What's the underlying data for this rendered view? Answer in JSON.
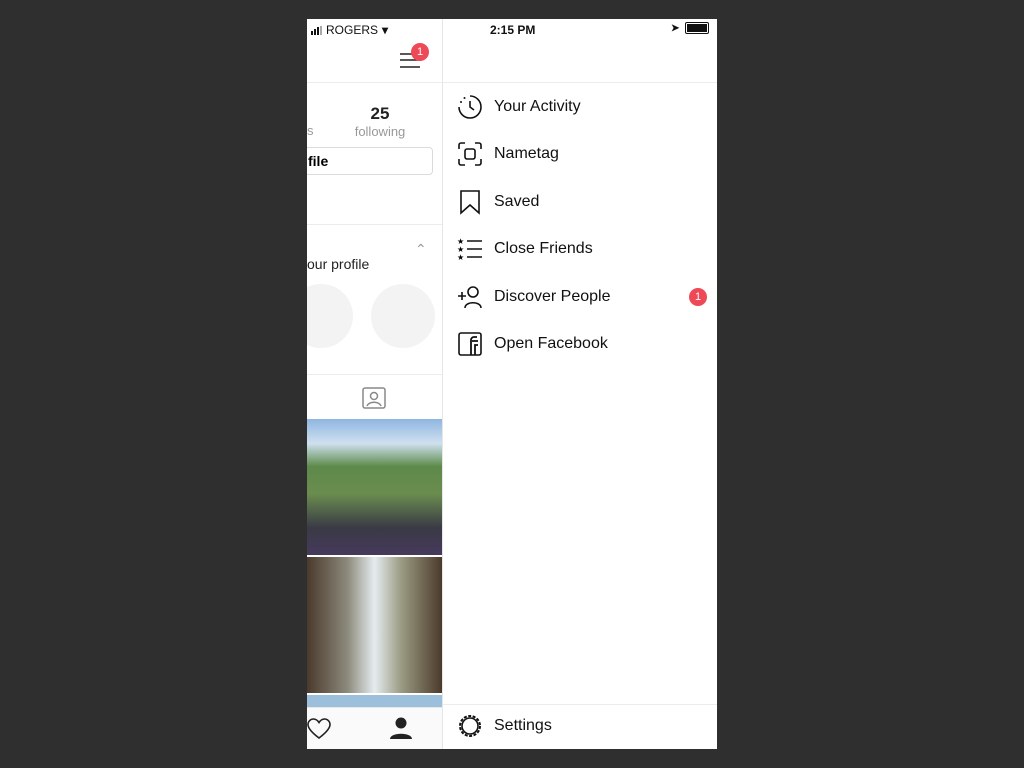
{
  "status_bar": {
    "carrier": "ROGERS",
    "time": "2:15 PM"
  },
  "profile": {
    "following_count": "25",
    "following_label": "following",
    "followers_label_partial": "s",
    "edit_profile_partial": "file",
    "suggested_partial": "our profile",
    "menu_badge": "1"
  },
  "menu": {
    "items": [
      {
        "label": "Your Activity",
        "icon": "activity-icon"
      },
      {
        "label": "Nametag",
        "icon": "nametag-icon"
      },
      {
        "label": "Saved",
        "icon": "bookmark-icon"
      },
      {
        "label": "Close Friends",
        "icon": "close-friends-icon"
      },
      {
        "label": "Discover People",
        "icon": "add-person-icon",
        "badge": "1"
      },
      {
        "label": "Open Facebook",
        "icon": "facebook-icon"
      }
    ],
    "settings": "Settings"
  },
  "colors": {
    "badge": "#ed4956",
    "background": "#2f2f2f"
  }
}
